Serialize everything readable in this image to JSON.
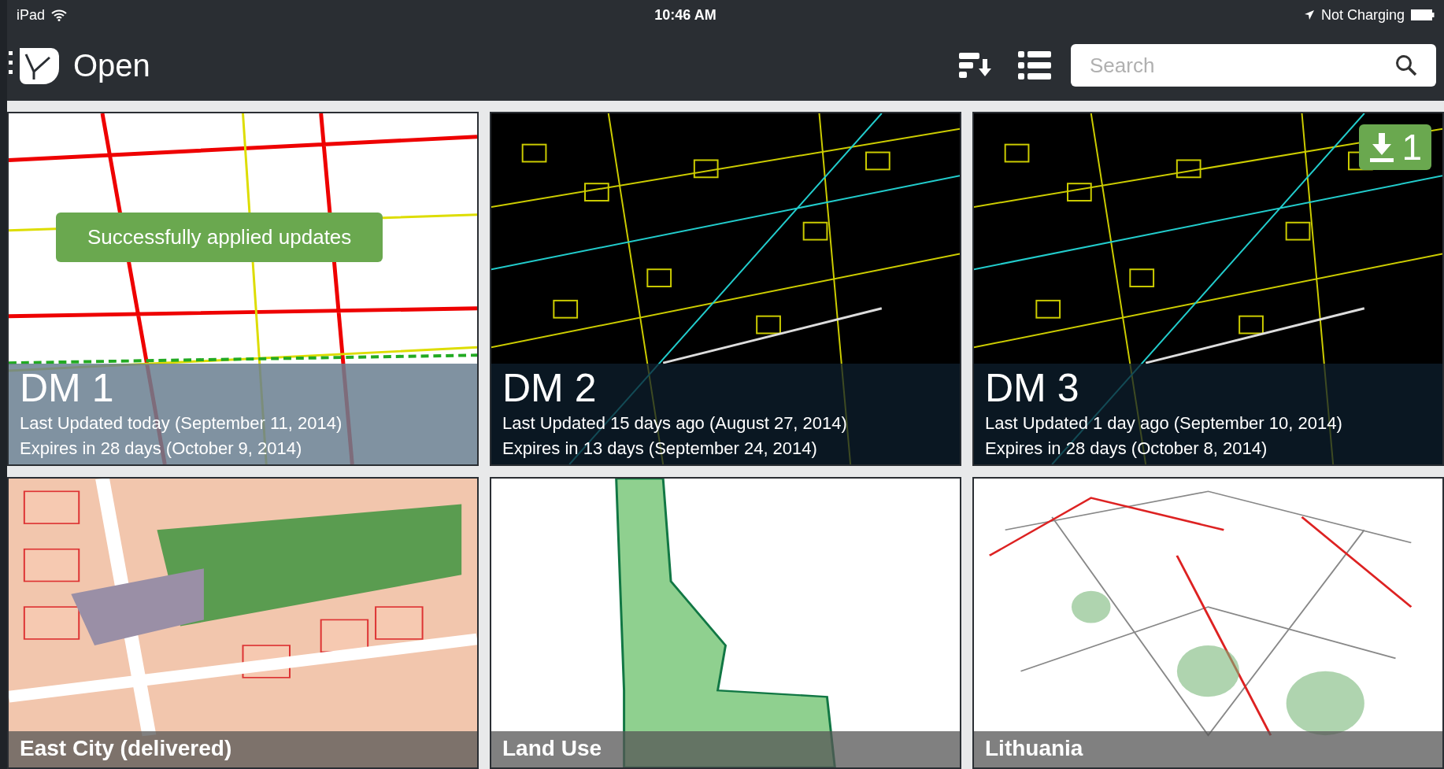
{
  "status_bar": {
    "device": "iPad",
    "time": "10:46 AM",
    "charging": "Not Charging"
  },
  "toolbar": {
    "title": "Open",
    "search": {
      "placeholder": "Search"
    }
  },
  "maps": [
    {
      "kind": "light",
      "name": "DM 1",
      "lines": [
        "Last Updated today (September 11, 2014)",
        "Expires in 28 days (October 9, 2014)"
      ],
      "toast": "Successfully applied updates"
    },
    {
      "kind": "dark",
      "name": "DM 2",
      "lines": [
        "Last Updated 15 days ago (August 27, 2014)",
        "Expires in 13 days (September 24, 2014)"
      ]
    },
    {
      "kind": "dark",
      "name": "DM 3",
      "lines": [
        "Last Updated 1 day ago (September 10, 2014)",
        "Expires in 28 days (October 8, 2014)"
      ],
      "badge": "1"
    },
    {
      "kind": "parcels",
      "name": "East City (delivered)"
    },
    {
      "kind": "region",
      "name": "Land Use"
    },
    {
      "kind": "network",
      "name": "Lithuania"
    }
  ]
}
